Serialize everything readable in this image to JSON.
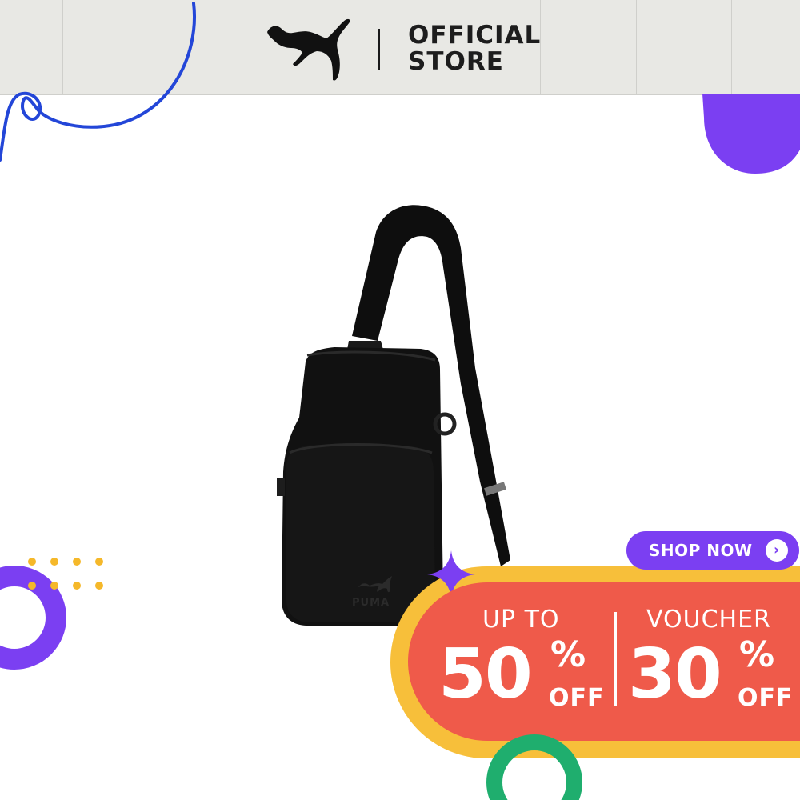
{
  "header": {
    "brand_logo": "puma-cat-logo",
    "store_line1": "OFFICIAL",
    "store_line2": "STORE"
  },
  "product": {
    "image": "black-puma-sling-bag",
    "bag_logo_text": "PUMA"
  },
  "promo": {
    "cta_label": "SHOP NOW",
    "cta_icon": "chevron-right-icon",
    "left_prefix": "UP TO",
    "left_value": "50",
    "left_suffix_pct": "%",
    "left_suffix_off": "OFF",
    "right_prefix": "VOUCHER",
    "right_value": "30",
    "right_suffix_pct": "%",
    "right_suffix_off": "OFF"
  },
  "colors": {
    "header_bg": "#e8e8e4",
    "accent_purple": "#7b3ff2",
    "promo_red": "#ef5a4a",
    "promo_yellow": "#f7bf3a",
    "deco_blue": "#2346d8",
    "deco_green": "#1fae6e",
    "deco_dots": "#f5b82a"
  }
}
